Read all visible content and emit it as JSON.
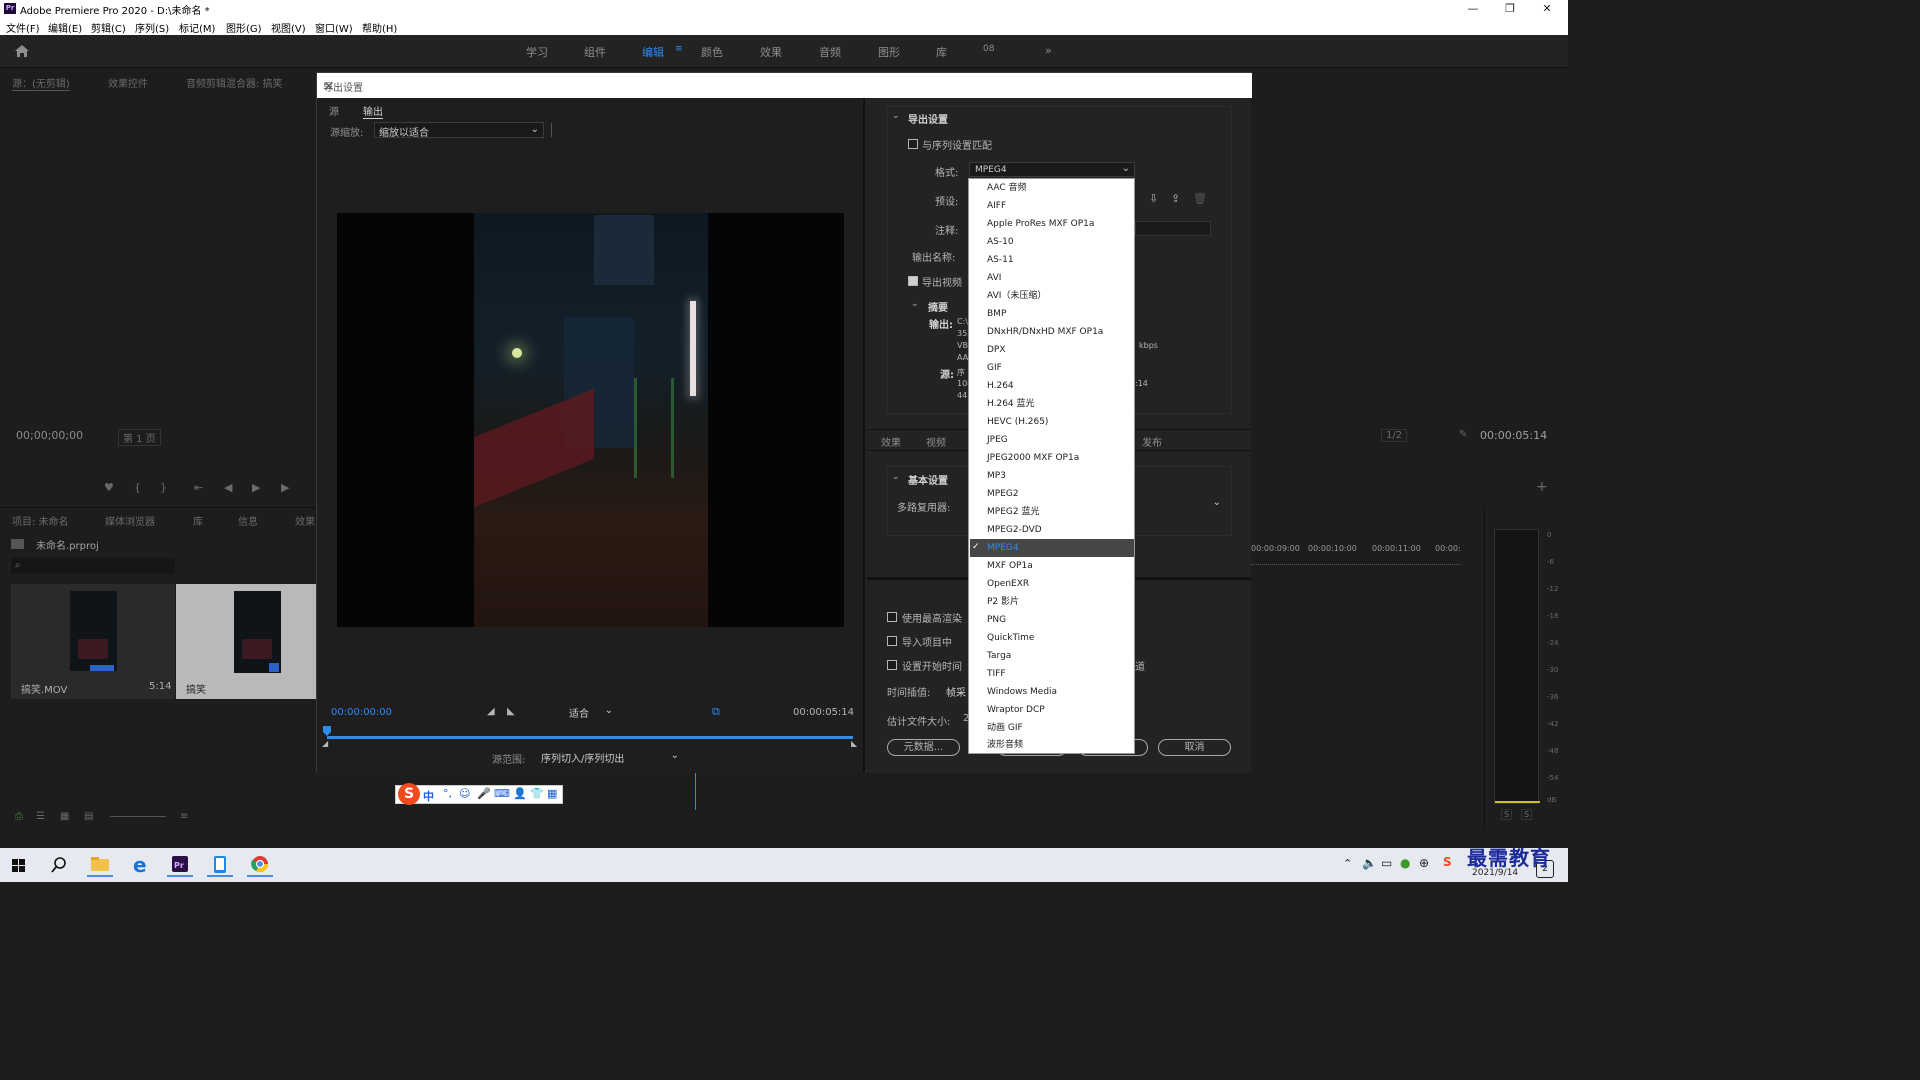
{
  "window": {
    "title": "Adobe Premiere Pro 2020 - D:\\未命名 *",
    "logo": "Pr"
  },
  "menu": [
    "文件(F)",
    "编辑(E)",
    "剪辑(C)",
    "序列(S)",
    "标记(M)",
    "图形(G)",
    "视图(V)",
    "窗口(W)",
    "帮助(H)"
  ],
  "workspaces": {
    "items": [
      "学习",
      "组件",
      "编辑",
      "颜色",
      "效果",
      "音频",
      "图形",
      "库",
      "08"
    ],
    "active": "编辑"
  },
  "source_panel": {
    "tabs": [
      "源：(无剪辑)",
      "效果控件",
      "音频剪辑混合器: 搞笑"
    ],
    "timecode": "00;00;00;00",
    "page": "第 1 页"
  },
  "program_panel": {
    "zoom": "1/2",
    "timecode": "00:00:05:14"
  },
  "project_panel": {
    "tabs": [
      "项目: 未命名",
      "媒体浏览器",
      "库",
      "信息",
      "效果"
    ],
    "project_file": "未命名.prproj",
    "items": [
      {
        "name": "搞笑.MOV",
        "duration": "5:14"
      },
      {
        "name": "搞笑",
        "duration": ""
      }
    ]
  },
  "timeline": {
    "ruler": [
      "00:00:09:00",
      "00:00:10:00",
      "00:00:11:00",
      "00:00:"
    ]
  },
  "audio_meter": {
    "ticks": [
      "0",
      "-6",
      "-12",
      "-18",
      "-24",
      "-30",
      "-36",
      "-42",
      "-48",
      "-54",
      "dB"
    ],
    "solo": [
      "S",
      "S"
    ]
  },
  "export_dialog": {
    "title": "导出设置",
    "left_tabs": [
      "源",
      "输出"
    ],
    "source_scaling_label": "源缩放:",
    "source_scaling_value": "缩放以适合",
    "current_time": "00:00:00:00",
    "fit_value": "适合",
    "end_time": "00:00:05:14",
    "source_range_label": "源范围:",
    "source_range_value": "序列切入/序列切出",
    "export_settings_header": "导出设置",
    "match_sequence_label": "与序列设置匹配",
    "format_label": "格式:",
    "format_value": "MPEG4",
    "preset_label": "预设:",
    "comments_label": "注释:",
    "output_name_label": "输出名称:",
    "export_video_label": "导出视频",
    "summary_header": "摘要",
    "summary_output_label": "输出:",
    "summary_output_lines": [
      "C:\\",
      "352",
      "VB",
      "AA"
    ],
    "summary_output_right": "kbps",
    "summary_source_label": "源:",
    "summary_source_lines": [
      "序",
      "108",
      "441"
    ],
    "summary_source_right": ":14",
    "bottom_tabs": [
      "效果",
      "视频",
      "发布"
    ],
    "basic_settings_header": "基本设置",
    "multiplexer_label": "多路复用器:",
    "max_render_label": "使用最高渲染",
    "import_project_label": "导入项目中",
    "set_start_tc_label": "设置开始时间",
    "right_partial_text": "道",
    "time_interp_label": "时间插值:",
    "time_interp_value": "帧采",
    "est_file_size_label": "估计文件大小:",
    "est_file_size_value": "2",
    "metadata_button": "元数据...",
    "cancel_button": "取消"
  },
  "format_options": [
    "AAC 音频",
    "AIFF",
    "Apple ProRes MXF OP1a",
    "AS-10",
    "AS-11",
    "AVI",
    "AVI（未压缩）",
    "BMP",
    "DNxHR/DNxHD MXF OP1a",
    "DPX",
    "GIF",
    "H.264",
    "H.264 蓝光",
    "HEVC (H.265)",
    "JPEG",
    "JPEG2000 MXF OP1a",
    "MP3",
    "MPEG2",
    "MPEG2 蓝光",
    "MPEG2-DVD",
    "MPEG4",
    "MXF OP1a",
    "OpenEXR",
    "P2 影片",
    "PNG",
    "QuickTime",
    "Targa",
    "TIFF",
    "Windows Media",
    "Wraptor DCP",
    "动画 GIF",
    "波形音频"
  ],
  "selected_format": "MPEG4",
  "ime": {
    "mode": "中"
  },
  "taskbar": {
    "date": "2021/9/14",
    "notification_count": "2"
  },
  "watermark": "最需教育",
  "colors": {
    "accent": "#2d8ceb",
    "dialog_bg": "#232323",
    "app_bg": "#1d1d1d",
    "taskbar": "#e6e9ef"
  }
}
